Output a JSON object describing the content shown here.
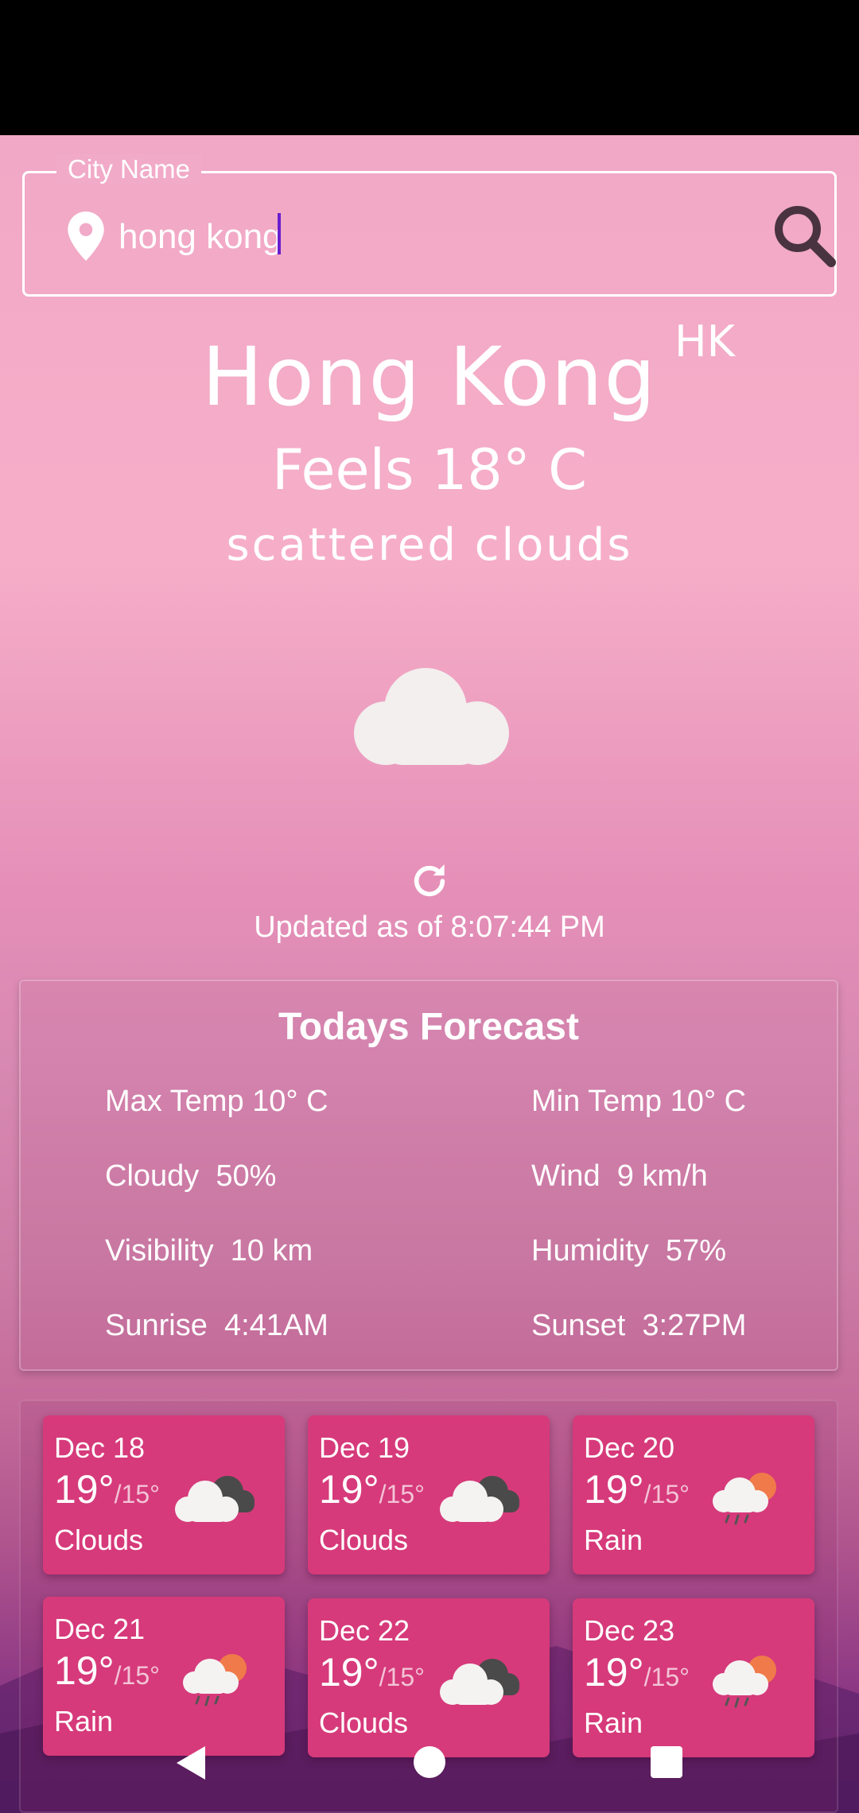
{
  "search": {
    "legend": "City Name",
    "value": "hong kong"
  },
  "current": {
    "city": "Hong Kong",
    "country": "HK",
    "feels": "Feels 18° C",
    "description": "scattered clouds",
    "weather_icon": "cloud-icon",
    "updated": "Updated as of 8:07:44 PM"
  },
  "today": {
    "title": "Todays Forecast",
    "max_temp": "Max Temp 10° C",
    "min_temp": "Min Temp 10° C",
    "cloudy": "Cloudy  50%",
    "wind": "Wind  9 km/h",
    "visibility": "Visibility  10 km",
    "humidity": "Humidity  57%",
    "sunrise": "Sunrise  4:41AM",
    "sunset": "Sunset  3:27PM"
  },
  "daily": [
    {
      "date": "Dec 18",
      "high": "19°",
      "low": "/15°",
      "cond": "Clouds",
      "icon": "clouds-icon"
    },
    {
      "date": "Dec 19",
      "high": "19°",
      "low": "/15°",
      "cond": "Clouds",
      "icon": "clouds-icon"
    },
    {
      "date": "Dec 20",
      "high": "19°",
      "low": "/15°",
      "cond": "Rain",
      "icon": "rain-sun-icon"
    },
    {
      "date": "Dec 21",
      "high": "19°",
      "low": "/15°",
      "cond": "Rain",
      "icon": "rain-sun-icon"
    },
    {
      "date": "Dec 22",
      "high": "19°",
      "low": "/15°",
      "cond": "Clouds",
      "icon": "clouds-icon"
    },
    {
      "date": "Dec 23",
      "high": "19°",
      "low": "/15°",
      "cond": "Rain",
      "icon": "rain-sun-icon"
    }
  ],
  "colors": {
    "card": "#d63a7a",
    "caret": "#6a1ecf"
  }
}
